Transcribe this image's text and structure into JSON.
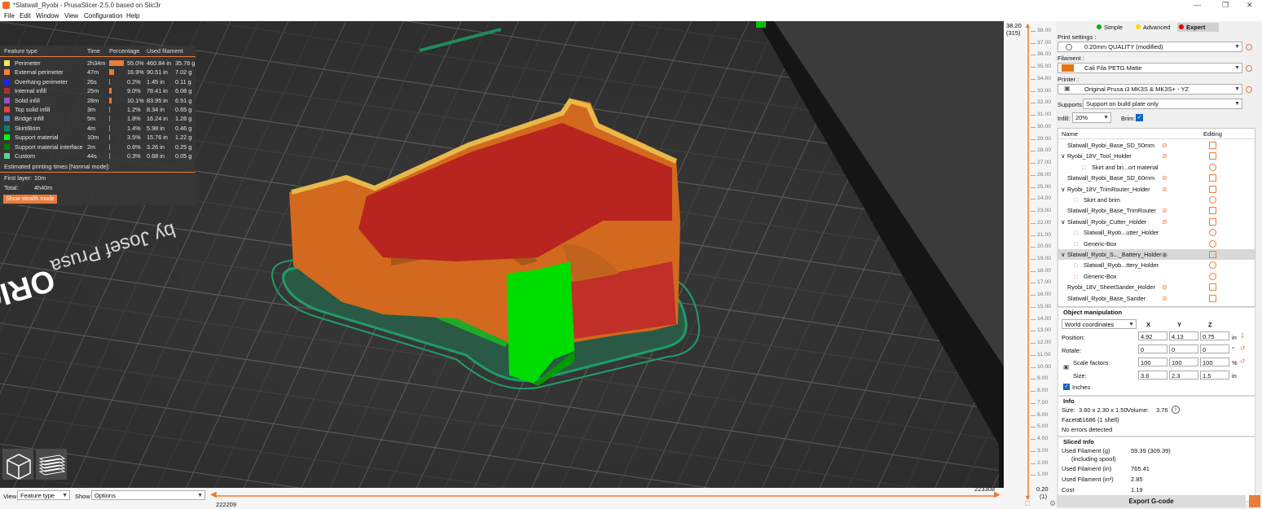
{
  "window": {
    "title": "*Slatwall_Ryobi - PrusaSlicer-2.5.0 based on Slic3r"
  },
  "menu": [
    "File",
    "Edit",
    "Window",
    "View",
    "Configuration",
    "Help"
  ],
  "legend": {
    "headers": {
      "type": "Feature type",
      "time": "Time",
      "percentage": "Percentage",
      "filament": "Used filament"
    },
    "rows": [
      {
        "name": "Perimeter",
        "time": "2h34m",
        "pct": "55.0%",
        "len": "460.84 in",
        "weight": "35.76 g",
        "color": "#ffe64d",
        "fraction": 0.55
      },
      {
        "name": "External perimeter",
        "time": "47m",
        "pct": "16.9%",
        "len": "90.51 in",
        "weight": "7.02 g",
        "color": "#ff7d38",
        "fraction": 0.169
      },
      {
        "name": "Overhang perimeter",
        "time": "26s",
        "pct": "0.2%",
        "len": "1.45 in",
        "weight": "0.11 g",
        "color": "#1f1fff",
        "fraction": 0.002
      },
      {
        "name": "Internal infill",
        "time": "25m",
        "pct": "9.0%",
        "len": "78.41 in",
        "weight": "6.08 g",
        "color": "#b03029",
        "fraction": 0.09
      },
      {
        "name": "Solid infill",
        "time": "28m",
        "pct": "10.1%",
        "len": "83.95 in",
        "weight": "6.51 g",
        "color": "#9654cc",
        "fraction": 0.101
      },
      {
        "name": "Top solid infill",
        "time": "3m",
        "pct": "1.2%",
        "len": "8.34 in",
        "weight": "0.65 g",
        "color": "#f04040",
        "fraction": 0.012
      },
      {
        "name": "Bridge infill",
        "time": "5m",
        "pct": "1.8%",
        "len": "16.24 in",
        "weight": "1.26 g",
        "color": "#4d80ba",
        "fraction": 0.018
      },
      {
        "name": "Skirt/Brim",
        "time": "4m",
        "pct": "1.4%",
        "len": "5.98 in",
        "weight": "0.46 g",
        "color": "#00876e",
        "fraction": 0.014
      },
      {
        "name": "Support material",
        "time": "10m",
        "pct": "3.5%",
        "len": "15.76 in",
        "weight": "1.22 g",
        "color": "#00ff00",
        "fraction": 0.035
      },
      {
        "name": "Support material interface",
        "time": "2m",
        "pct": "0.6%",
        "len": "3.26 in",
        "weight": "0.25 g",
        "color": "#008000",
        "fraction": 0.006
      },
      {
        "name": "Custom",
        "time": "44s",
        "pct": "0.3%",
        "len": "0.68 in",
        "weight": "0.05 g",
        "color": "#5ed194",
        "fraction": 0.003
      }
    ],
    "estimate_label": "Estimated printing times [Normal mode]:",
    "first_layer_label": "First layer:",
    "first_layer_value": "10m",
    "total_label": "Total:",
    "total_value": "4h40m",
    "stealth_button": "Show stealth mode"
  },
  "bed": {
    "brand_text": "ORIGINAL PRUSA i3 MK3",
    "sub_text": "by Josef Prusa"
  },
  "bottom": {
    "view_label": "View",
    "view_value": "Feature type",
    "show_label": "Show",
    "show_value": "Options",
    "slider_right": "223308",
    "slider_left": "222209"
  },
  "layer_slider": {
    "top_value": "38.20",
    "top_layer": "(315)",
    "bottom_value": "0.20",
    "bottom_layer": "(1)",
    "ticks": [
      "38.00",
      "37.00",
      "36.00",
      "35.00",
      "34.00",
      "33.00",
      "32.00",
      "31.00",
      "30.00",
      "29.00",
      "28.00",
      "27.00",
      "26.00",
      "25.00",
      "24.00",
      "23.00",
      "22.00",
      "21.00",
      "20.00",
      "19.00",
      "18.00",
      "17.00",
      "16.00",
      "15.00",
      "14.00",
      "13.00",
      "12.00",
      "11.00",
      "10.00",
      "9.00",
      "8.00",
      "7.00",
      "6.00",
      "5.00",
      "4.00",
      "3.00",
      "2.00",
      "1.00"
    ]
  },
  "modes": {
    "simple": "Simple",
    "advanced": "Advanced",
    "expert": "Expert",
    "simple_color": "#00b000",
    "advanced_color": "#ffd800",
    "expert_color": "#e00000"
  },
  "settings": {
    "print_label": "Print settings :",
    "print_value": "0.20mm QUALITY (modified)",
    "filament_label": "Filament :",
    "filament_value": "Cali Fila PETG Matte",
    "filament_color": "#e8730f",
    "printer_label": "Printer :",
    "printer_value": "Original Prusa i3 MK3S & MK3S+ - YZ",
    "supports_label": "Supports:",
    "supports_value": "Support on build plate only",
    "infill_label": "Infill:",
    "infill_value": "20%",
    "brim_label": "Brim:"
  },
  "objects": {
    "col_name": "Name",
    "col_editing": "Editing",
    "rows": [
      {
        "name": "Slatwall_Ryobi_Base_SD_50mm",
        "indent": 0
      },
      {
        "name": "Ryobi_18V_Tool_Holder",
        "indent": 0,
        "expander": true
      },
      {
        "name": "Skirt and bri...ort material",
        "indent": 2
      },
      {
        "name": "Slatwall_Ryobi_Base_SD_60mm",
        "indent": 0
      },
      {
        "name": "Ryobi_18V_TrimRouter_Holder",
        "indent": 0,
        "expander": true
      },
      {
        "name": "Skirt and brim",
        "indent": 1
      },
      {
        "name": "Slatwall_Ryobi_Base_TrimRouter",
        "indent": 0
      },
      {
        "name": "Slatwall_Ryobi_Cutter_Holder",
        "indent": 0,
        "expander": true
      },
      {
        "name": "Slatwall_Ryob...utter_Holder",
        "indent": 1
      },
      {
        "name": "Generic-Box",
        "indent": 1
      },
      {
        "name": "Slatwall_Ryobi_S..._Battery_Holder",
        "indent": 0,
        "expander": true,
        "selected": true
      },
      {
        "name": "Slatwall_Ryob...ttery_Holder",
        "indent": 1
      },
      {
        "name": "Generic-Box",
        "indent": 1
      },
      {
        "name": "Ryobi_18V_SheetSander_Holder",
        "indent": 0
      },
      {
        "name": "Slatwall_Ryobi_Base_Sander",
        "indent": 0
      }
    ]
  },
  "manip": {
    "title": "Object manipulation",
    "coords": "World coordinates",
    "x": "X",
    "y": "Y",
    "z": "Z",
    "position_label": "Position:",
    "pos": [
      "4.92",
      "4.13",
      "0.75"
    ],
    "pos_unit": "in",
    "rotate_label": "Rotate:",
    "rot": [
      "0",
      "0",
      "0"
    ],
    "rot_unit": "°",
    "scale_label": "Scale factors:",
    "scale": [
      "100",
      "100",
      "100"
    ],
    "scale_unit": "%",
    "size_label": "Size:",
    "size": [
      "3.6",
      "2.3",
      "1.5"
    ],
    "size_unit": "in",
    "inches_label": "Inches"
  },
  "info": {
    "title": "Info",
    "size_label": "Size:",
    "size_value": "3.60 x 2.30 x 1.50",
    "volume_label": "Volume:",
    "volume_value": "3.76",
    "facets_label": "Facets:",
    "facets_value": "61686 (1 shell)",
    "errors": "No errors detected"
  },
  "sliced": {
    "title": "Sliced Info",
    "g_label": "Used Filament (g)",
    "g_sub": "(including spool)",
    "g_value": "59.39 (309.39)",
    "in_label": "Used Filament (in)",
    "in_value": "765.41",
    "in3_label": "Used Filament (in³)",
    "in3_value": "2.85",
    "cost_label": "Cost",
    "cost_value": "1.19"
  },
  "export_button": "Export G-code"
}
